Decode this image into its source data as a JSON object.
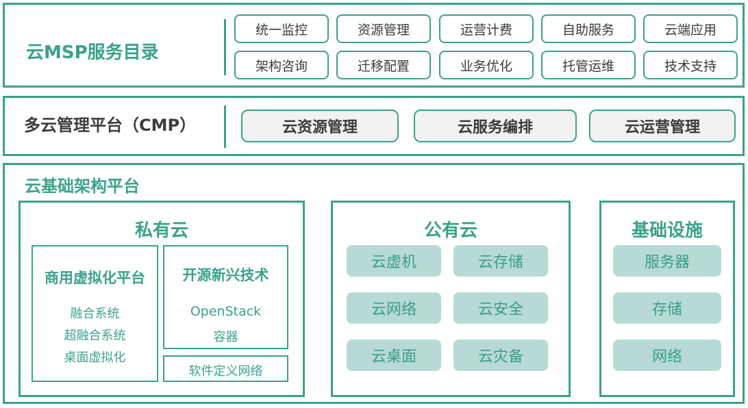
{
  "msp": {
    "title": "云MSP服务目录",
    "services_row1": [
      "统一监控",
      "资源管理",
      "运营计费",
      "自助服务",
      "云端应用"
    ],
    "services_row2": [
      "架构咨询",
      "迁移配置",
      "业务优化",
      "托管运维",
      "技术支持"
    ]
  },
  "cmp": {
    "title": "多云管理平台（CMP）",
    "items": [
      "云资源管理",
      "云服务编排",
      "云运营管理"
    ]
  },
  "infra": {
    "title": "云基础架构平台",
    "private_cloud": {
      "title": "私有云",
      "commercial": {
        "title": "商用虚拟化平台",
        "items": [
          "融合系统",
          "超融合系统",
          "桌面虚拟化"
        ]
      },
      "open_source": {
        "title": "开源新兴技术",
        "items": [
          "OpenStack",
          "容器"
        ]
      },
      "sdn": "软件定义网络"
    },
    "public_cloud": {
      "title": "公有云",
      "items": [
        "云虚机",
        "云存储",
        "云网络",
        "云安全",
        "云桌面",
        "云灾备"
      ]
    },
    "infrastructure": {
      "title": "基础设施",
      "items": [
        "服务器",
        "存储",
        "网络"
      ]
    }
  },
  "colors": {
    "accent": "#3aa28a",
    "pill_fill": "#b7dbd4",
    "button_fill": "#f2f2f2"
  }
}
